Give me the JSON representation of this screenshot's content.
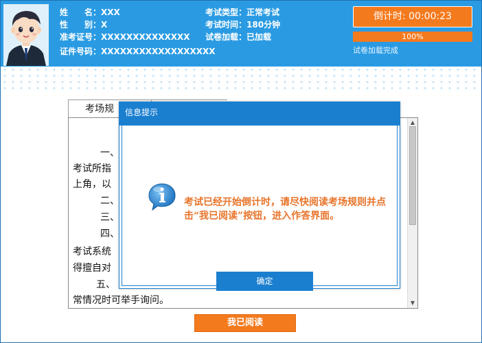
{
  "candidate": {
    "name_label": "姓　　名：",
    "name_value": "XXX",
    "gender_label": "性　　别：",
    "gender_value": "X",
    "admission_label": "准考证号：",
    "admission_value": "XXXXXXXXXXXXXX",
    "id_label": "证件号码：",
    "id_value": "XXXXXXXXXXXXXXXXXX"
  },
  "exam": {
    "type_label": "考试类型：",
    "type_value": "正常考试",
    "time_label": "考试时间：",
    "time_value": "180分钟",
    "load_label": "试卷加载：",
    "load_value": "已加载"
  },
  "countdown": {
    "label": "倒计时: 00:00:23"
  },
  "progress": {
    "percent_text": "100%",
    "value": 100,
    "status": "试卷加载完成"
  },
  "rules": {
    "tab_label": "考场规",
    "lines": [
      "一、",
      "考试所指",
      "上角，以",
      "二、",
      "三、",
      "四、",
      "考试系统",
      "得擅自对",
      "五、",
      "常情况时可举手询问。"
    ]
  },
  "read_button": {
    "label": "我已阅读"
  },
  "modal": {
    "title": "信息提示",
    "message": "考试已经开始倒计时，请尽快阅读考场规则并点击“我已阅读”按钮，进入作答界面。",
    "ok_label": "确定"
  },
  "colors": {
    "header": "#2a9be3",
    "accent": "#f47a1e",
    "modal": "#1b7fd0",
    "message": "#e8742a"
  }
}
